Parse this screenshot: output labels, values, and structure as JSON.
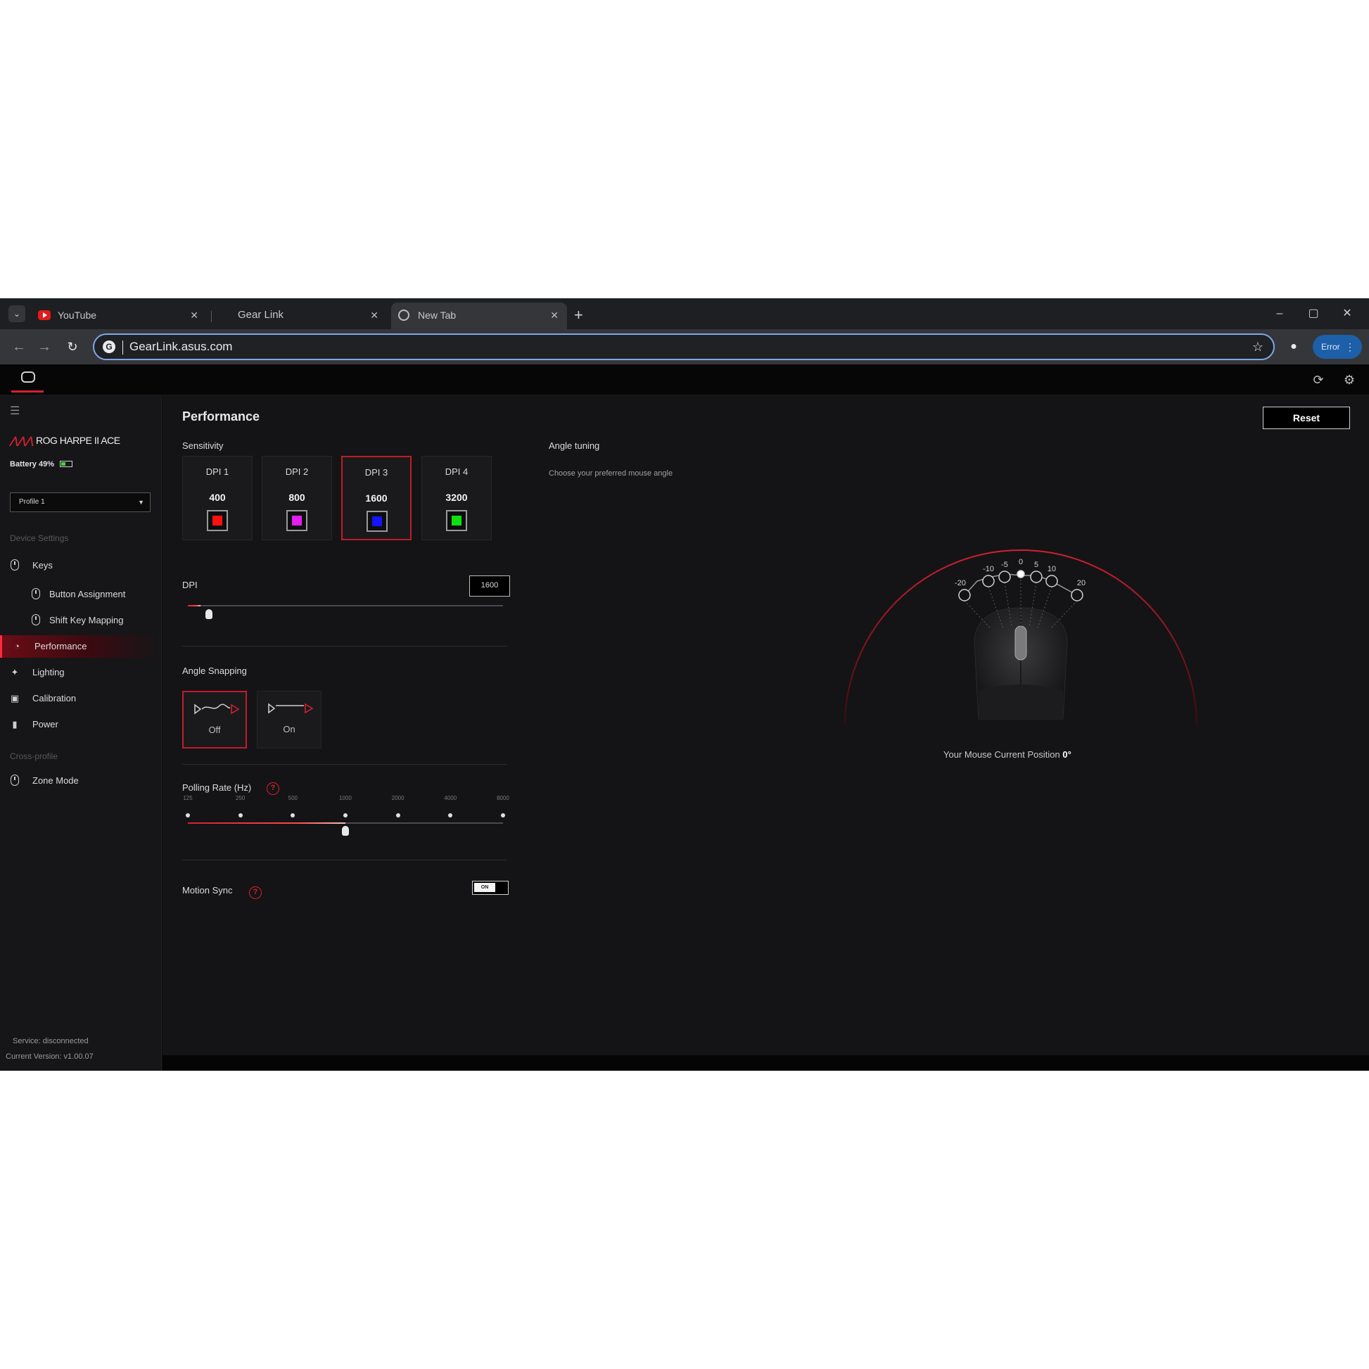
{
  "browser": {
    "tabs": [
      {
        "label": "YouTube",
        "icon": "youtube-icon",
        "active": false
      },
      {
        "label": "Gear Link",
        "icon": "",
        "active": false
      },
      {
        "label": "New Tab",
        "icon": "globe-icon",
        "active": true
      }
    ],
    "new_tab": "+",
    "window_controls": {
      "minimize": "–",
      "maximize": "▢",
      "close": "✕"
    },
    "url": "GearLink.asus.com",
    "error_button": "Error"
  },
  "sidebar": {
    "device_name_prefix": "ROG",
    "device_name": "ROG HARPE II ACE",
    "battery": "Battery 49%",
    "profile": "Profile 1",
    "section_device_settings": "Device Settings",
    "items": [
      {
        "label": "Keys",
        "icon": "mouse-icon",
        "level": "top",
        "active": false
      },
      {
        "label": "Button Assignment",
        "icon": "mouse-icon",
        "level": "sub",
        "active": false
      },
      {
        "label": "Shift Key Mapping",
        "icon": "mouse-icon",
        "level": "sub",
        "active": false
      },
      {
        "label": "Performance",
        "icon": "gauge-icon",
        "level": "top",
        "active": true
      },
      {
        "label": "Lighting",
        "icon": "lighting-icon",
        "level": "top",
        "active": false
      },
      {
        "label": "Calibration",
        "icon": "calibration-icon",
        "level": "top",
        "active": false
      },
      {
        "label": "Power",
        "icon": "battery-icon",
        "level": "top",
        "active": false
      }
    ],
    "section_cross_profile": "Cross-profile",
    "zone_mode": "Zone Mode",
    "service_status": "Service: disconnected",
    "version": "Current Version: v1.00.07"
  },
  "main": {
    "title": "Performance",
    "reset": "Reset",
    "sensitivity": {
      "label": "Sensitivity",
      "cards": [
        {
          "label": "DPI 1",
          "value": "400",
          "color": "#ff1010",
          "selected": false
        },
        {
          "label": "DPI 2",
          "value": "800",
          "color": "#e21ef0",
          "selected": false
        },
        {
          "label": "DPI 3",
          "value": "1600",
          "color": "#1414ff",
          "selected": true
        },
        {
          "label": "DPI 4",
          "value": "3200",
          "color": "#10e010",
          "selected": false
        }
      ]
    },
    "dpi": {
      "label": "DPI",
      "value": "1600",
      "fraction": 0.04
    },
    "angle_snapping": {
      "label": "Angle Snapping",
      "off": "Off",
      "on": "On",
      "selected": "Off"
    },
    "polling_rate": {
      "label": "Polling Rate (Hz)",
      "ticks": [
        "125",
        "250",
        "500",
        "1000",
        "2000",
        "4000",
        "8000"
      ],
      "selected": "1000"
    },
    "motion_sync": {
      "label": "Motion Sync",
      "toggle": "ON"
    },
    "help_symbol": "?"
  },
  "angle_tuning": {
    "label": "Angle tuning",
    "description": "Choose your preferred mouse angle",
    "marks": [
      "-20",
      "-10",
      "-5",
      "0",
      "5",
      "10",
      "20"
    ],
    "selected": "0",
    "position_label": "Your Mouse Current Position",
    "position_value": "0°"
  },
  "colors": {
    "accent": "#d42030",
    "background": "#141416"
  }
}
